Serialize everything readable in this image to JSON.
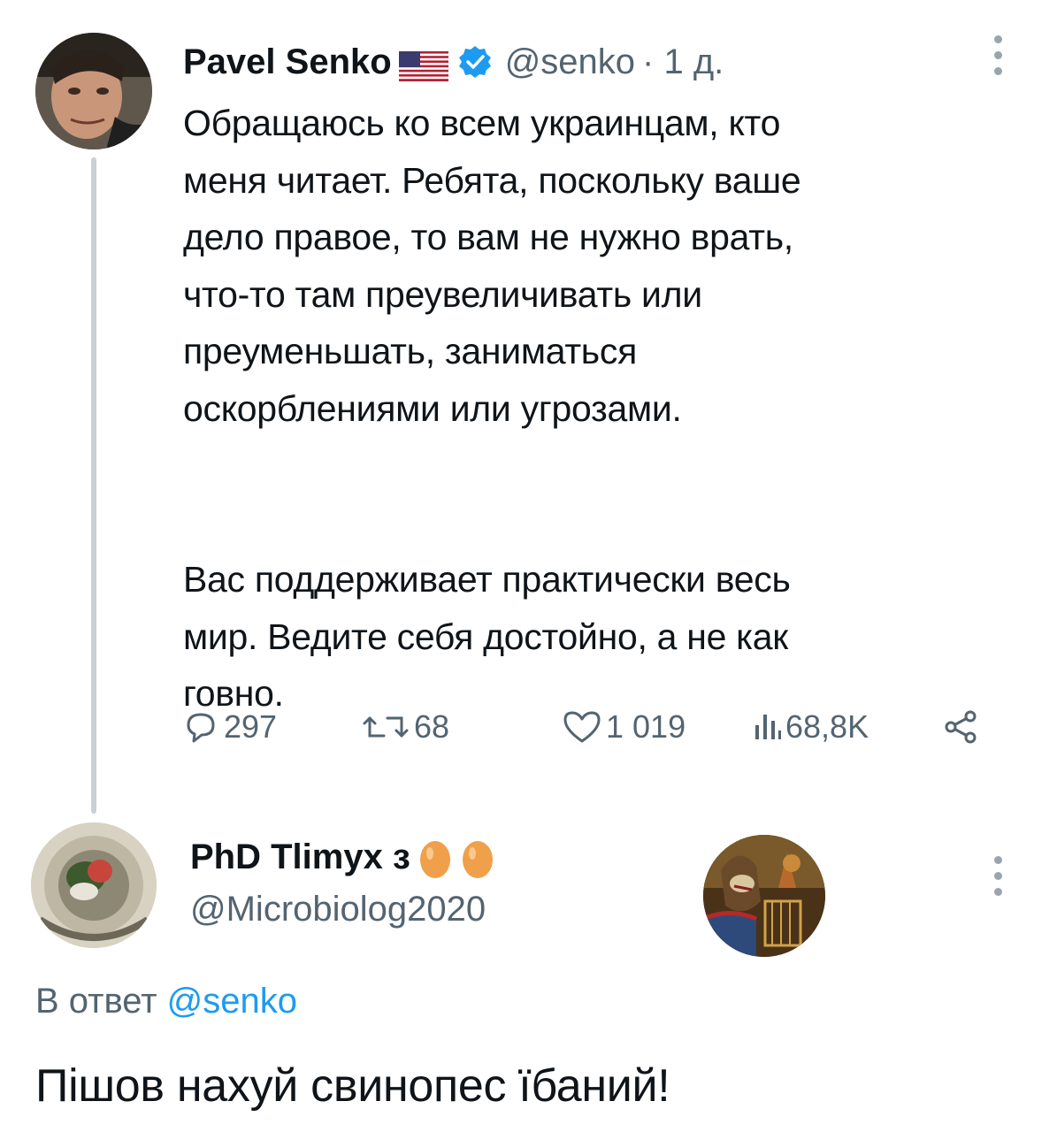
{
  "tweet": {
    "author_name": "Pavel Senko",
    "flag_icon": "us-flag-icon",
    "verified_icon": "verified-badge-icon",
    "handle": "@senko",
    "time": "· 1 д.",
    "paragraphs": [
      [
        "Обращаюсь ко всем украинцам, кто",
        "меня читает. Ребята, поскольку ваше",
        "дело правое, то вам не нужно врать,",
        "что-то там преувеличивать или",
        "преуменьшать, заниматься",
        "оскорблениями или угрозами."
      ],
      [
        "Вас поддерживает практически весь",
        "мир. Ведите себя достойно, а не как",
        "говно."
      ]
    ],
    "stats": {
      "replies": "297",
      "retweets": "68",
      "likes": "1 019",
      "views": "68,8K"
    }
  },
  "reply": {
    "author_name": "PhD Tlimyx з",
    "egg_icons": [
      "egg-icon",
      "egg-icon"
    ],
    "handle": "@Microbiolog2020",
    "reply_prefix": "В ответ",
    "reply_mention": "@senko",
    "text": "Пішов нахуй свинопес їбаний!"
  },
  "colors": {
    "text": "#0f1419",
    "secondary": "#536471",
    "link": "#1d9bf0",
    "thread_line": "#c9d0d6"
  }
}
